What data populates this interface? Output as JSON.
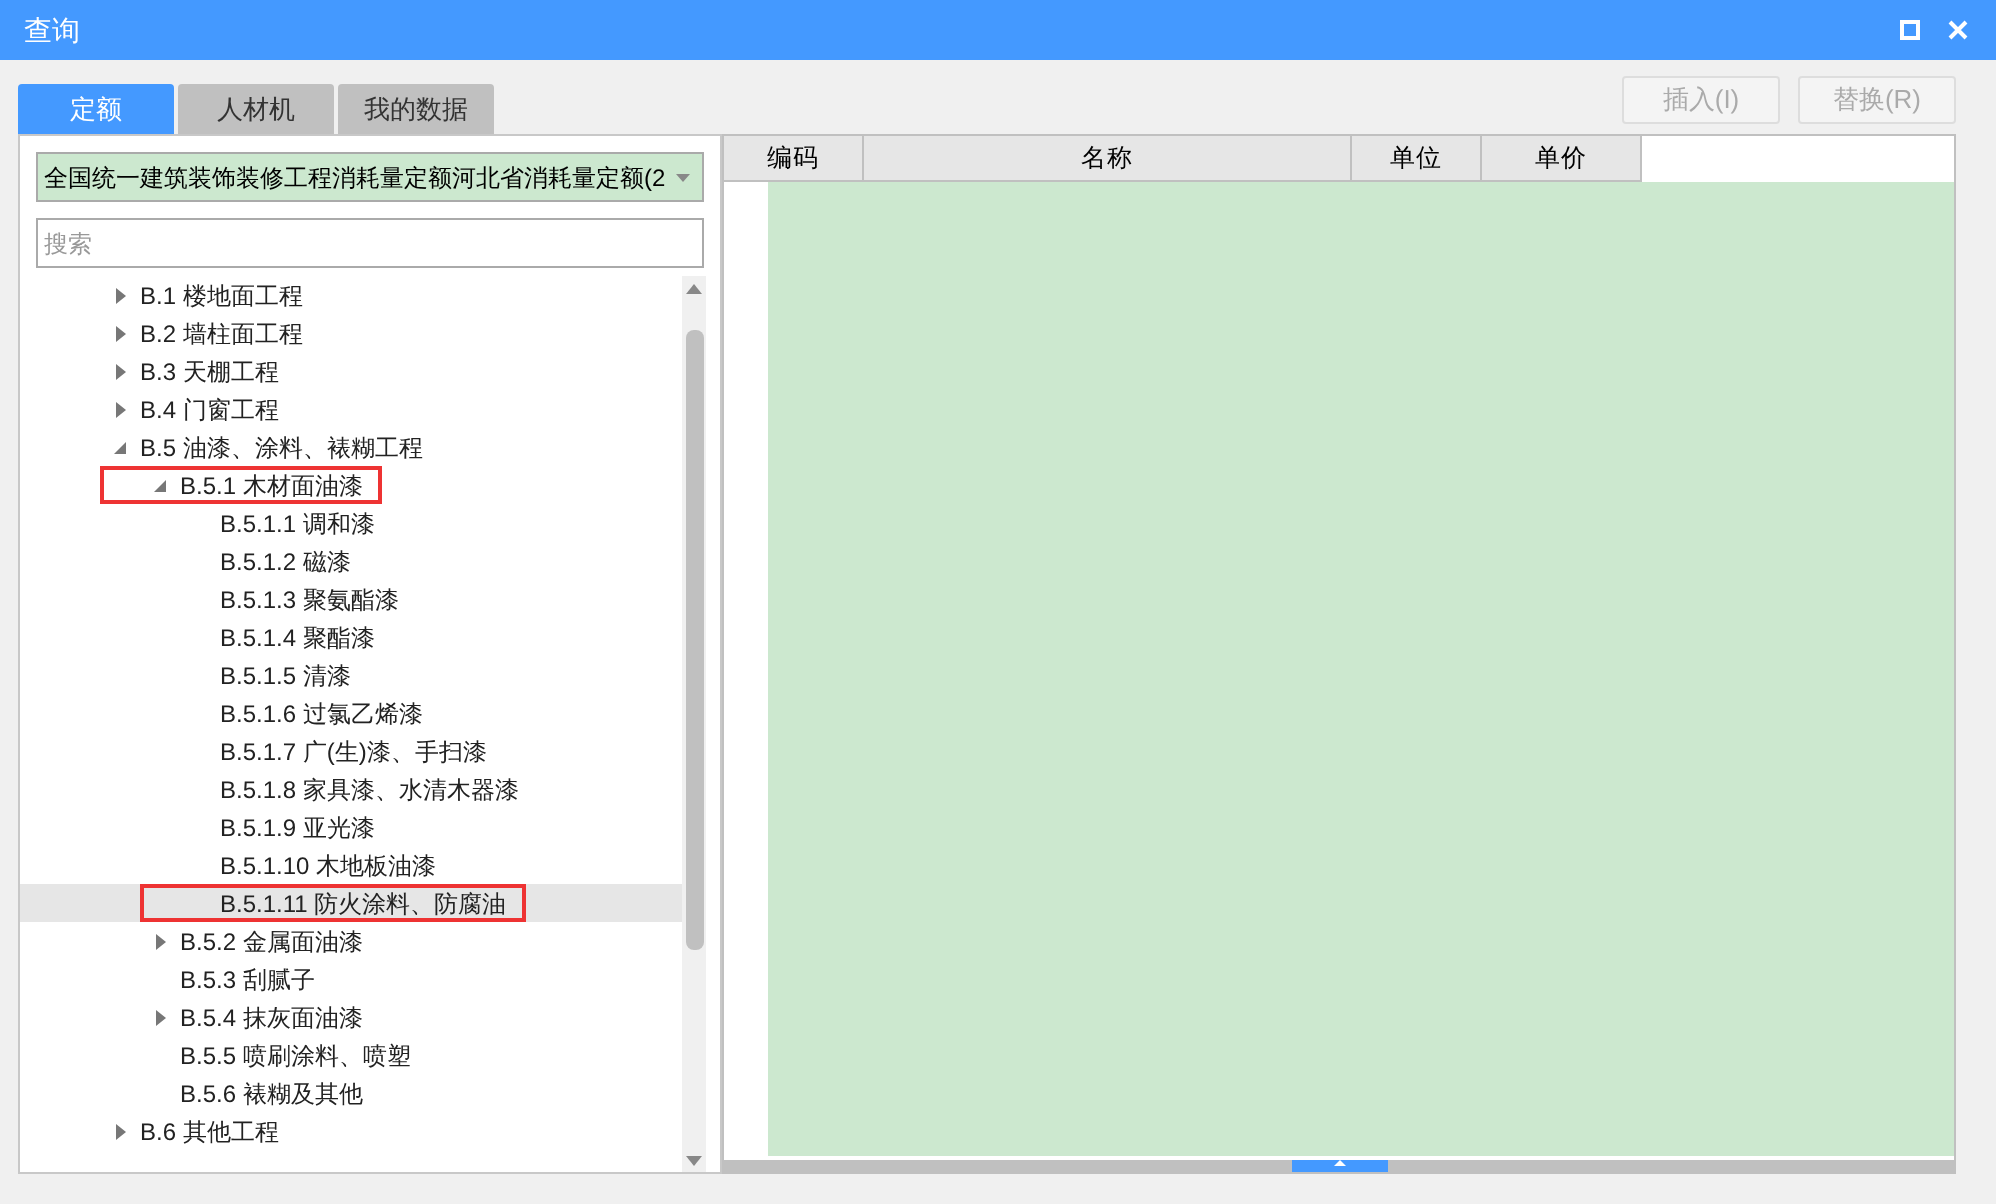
{
  "window": {
    "title": "查询"
  },
  "tabs": [
    {
      "label": "定额",
      "selected": true
    },
    {
      "label": "人材机",
      "selected": false
    },
    {
      "label": "我的数据",
      "selected": false
    }
  ],
  "actions": [
    {
      "label": "插入(I)",
      "disabled": true
    },
    {
      "label": "替换(R)",
      "disabled": true
    }
  ],
  "library_select": {
    "value": "全国统一建筑装饰装修工程消耗量定额河北省消耗量定额(2"
  },
  "search": {
    "placeholder": "搜索"
  },
  "tree": [
    {
      "label": "B.1 楼地面工程",
      "expanded": false,
      "selected": false,
      "annotated": false
    },
    {
      "label": "B.2 墙柱面工程",
      "expanded": false,
      "selected": false,
      "annotated": false
    },
    {
      "label": "B.3 天棚工程",
      "expanded": false,
      "selected": false,
      "annotated": false
    },
    {
      "label": "B.4 门窗工程",
      "expanded": false,
      "selected": false,
      "annotated": false
    },
    {
      "label": "B.5 油漆、涂料、裱糊工程",
      "expanded": true,
      "selected": false,
      "annotated": false,
      "children": [
        {
          "label": "B.5.1 木材面油漆",
          "expanded": true,
          "selected": false,
          "annotated": true,
          "children": [
            {
              "label": "B.5.1.1 调和漆",
              "selected": false,
              "annotated": false
            },
            {
              "label": "B.5.1.2 磁漆",
              "selected": false,
              "annotated": false
            },
            {
              "label": "B.5.1.3 聚氨酯漆",
              "selected": false,
              "annotated": false
            },
            {
              "label": "B.5.1.4 聚酯漆",
              "selected": false,
              "annotated": false
            },
            {
              "label": "B.5.1.5 清漆",
              "selected": false,
              "annotated": false
            },
            {
              "label": "B.5.1.6 过氯乙烯漆",
              "selected": false,
              "annotated": false
            },
            {
              "label": "B.5.1.7 广(生)漆、手扫漆",
              "selected": false,
              "annotated": false
            },
            {
              "label": "B.5.1.8 家具漆、水清木器漆",
              "selected": false,
              "annotated": false
            },
            {
              "label": "B.5.1.9 亚光漆",
              "selected": false,
              "annotated": false
            },
            {
              "label": "B.5.1.10 木地板油漆",
              "selected": false,
              "annotated": false
            },
            {
              "label": "B.5.1.11 防火涂料、防腐油",
              "selected": true,
              "annotated": true
            }
          ]
        },
        {
          "label": "B.5.2 金属面油漆",
          "expanded": false,
          "selected": false,
          "annotated": false
        },
        {
          "label": "B.5.3 刮腻子",
          "selected": false,
          "annotated": false
        },
        {
          "label": "B.5.4 抹灰面油漆",
          "expanded": false,
          "selected": false,
          "annotated": false
        },
        {
          "label": "B.5.5 喷刷涂料、喷塑",
          "selected": false,
          "annotated": false
        },
        {
          "label": "B.5.6 裱糊及其他",
          "selected": false,
          "annotated": false
        }
      ]
    },
    {
      "label": "B.6 其他工程",
      "expanded": false,
      "selected": false,
      "annotated": false
    }
  ],
  "table": {
    "columns": [
      "编码",
      "名称",
      "单位",
      "单价"
    ]
  }
}
